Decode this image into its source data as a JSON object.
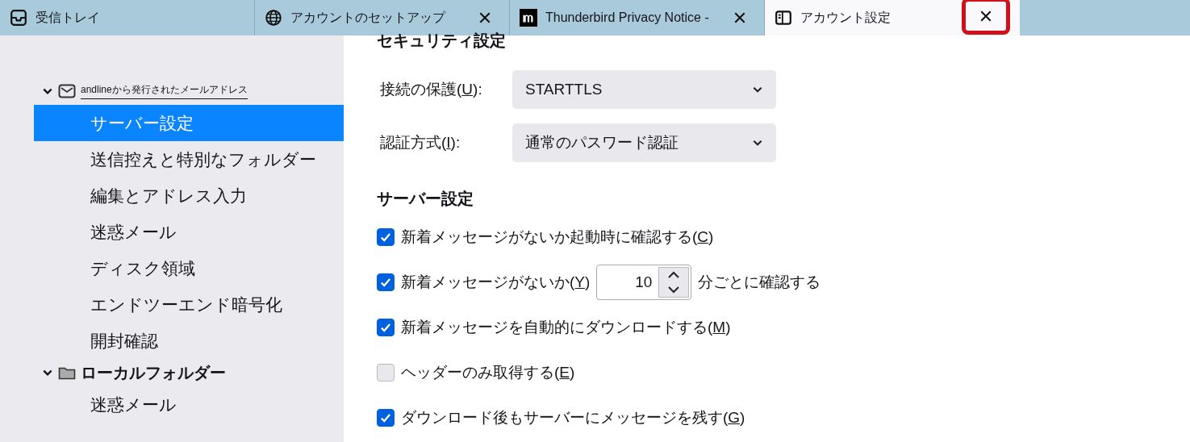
{
  "tabs": [
    {
      "label": "受信トレイ",
      "closable": false,
      "selected": false
    },
    {
      "label": "アカウントのセットアップ",
      "closable": true,
      "selected": false
    },
    {
      "label": "Thunderbird Privacy Notice -",
      "closable": true,
      "selected": false
    },
    {
      "label": "アカウント設定",
      "closable": true,
      "selected": true,
      "close_highlighted": true
    }
  ],
  "sidebar": {
    "items": [
      {
        "label": "andlineから発行されたメールアドレス",
        "expanded": true,
        "focused": true,
        "children": [
          {
            "label": "サーバー設定",
            "selected": true
          },
          {
            "label": "送信控えと特別なフォルダー",
            "selected": false
          },
          {
            "label": "編集とアドレス入力",
            "selected": false
          },
          {
            "label": "迷惑メール",
            "selected": false
          },
          {
            "label": "ディスク領域",
            "selected": false
          },
          {
            "label": "エンドツーエンド暗号化",
            "selected": false
          },
          {
            "label": "開封確認",
            "selected": false
          }
        ]
      },
      {
        "label": "ローカルフォルダー",
        "expanded": true,
        "focused": false,
        "children": [
          {
            "label": "迷惑メール",
            "selected": false
          }
        ]
      }
    ]
  },
  "security": {
    "heading": "セキュリティ設定",
    "fields": [
      {
        "label": "接続の保護(U):",
        "value": "STARTTLS"
      },
      {
        "label": "認証方式(I):",
        "value": "通常のパスワード認証"
      }
    ]
  },
  "server": {
    "heading": "サーバー設定",
    "options": [
      {
        "kind": "check",
        "label": "新着メッセージがないか起動時に確認する(C)",
        "checked": true
      },
      {
        "kind": "interval",
        "label": "新着メッセージがないか(Y)",
        "checked": true,
        "value": "10",
        "suffix": "分ごとに確認する"
      },
      {
        "kind": "check",
        "label": "新着メッセージを自動的にダウンロードする(M)",
        "checked": true
      },
      {
        "kind": "check",
        "label": "ヘッダーのみ取得する(E)",
        "checked": false
      },
      {
        "kind": "check",
        "label": "ダウンロード後もサーバーにメッセージを残す(G)",
        "checked": true
      }
    ]
  }
}
